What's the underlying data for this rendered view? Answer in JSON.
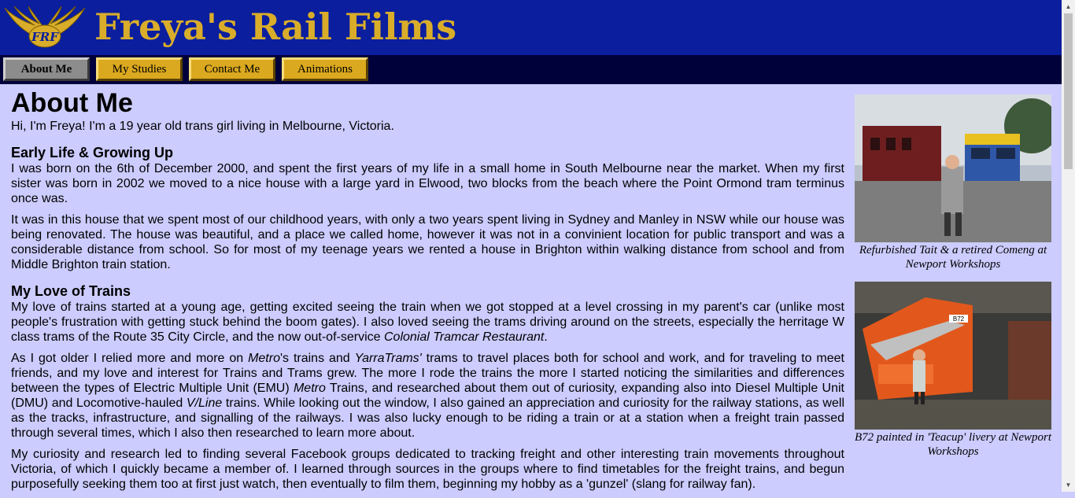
{
  "header": {
    "logo_text": "FRF",
    "site_title": "Freya's Rail Films"
  },
  "nav": [
    {
      "label": "About Me",
      "active": true
    },
    {
      "label": "My Studies",
      "active": false
    },
    {
      "label": "Contact Me",
      "active": false
    },
    {
      "label": "Animations",
      "active": false
    }
  ],
  "main": {
    "title": "About Me",
    "intro": "Hi, I'm Freya! I'm a 19 year old trans girl living in Melbourne, Victoria.",
    "sections": [
      {
        "heading": "Early Life & Growing Up",
        "paragraphs": [
          "I was born on the 6th of December 2000, and spent the first years of my life in a small home in South Melbourne near the market. When my first sister was born in 2002 we moved to a nice house with a large yard in Elwood, two blocks from the beach where the Point Ormond tram terminus once was.",
          "It was in this house that we spent most of our childhood years, with only a two years spent living in Sydney and Manley in NSW while our house was being renovated. The house was beautiful, and a place we called home, however it was not in a convinient location for public transport and was a considerable distance from school. So for most of my teenage years we rented a house in Brighton within walking distance from school and from Middle Brighton train station."
        ]
      },
      {
        "heading": "My Love of Trains",
        "p1_a": "My love of trains started at a young age, getting excited seeing the train when we got stopped at a level crossing in my parent's car (unlike most people's frustration with getting stuck behind the boom gates). I also loved seeing the trams driving around on the streets, especially the herritage W class trams of the Route 35 City Circle, and the now out-of-service ",
        "p1_em": "Colonial Tramcar Restaurant",
        "p1_b": ".",
        "p2_a": "As I got older I relied more and more on ",
        "p2_em1": "Metro",
        "p2_b": "'s trains and ",
        "p2_em2": "YarraTrams'",
        "p2_c": " trams to travel places both for school and work, and for traveling to meet friends, and my love and interest for Trains and Trams grew. The more I rode the trains the more I started noticing the similarities and differences between the types of Electric Multiple Unit (EMU) ",
        "p2_em3": "Metro",
        "p2_d": " Trains, and researched about them out of curiosity, expanding also into Diesel Multiple Unit (DMU) and Locomotive-hauled ",
        "p2_em4": "V/Line",
        "p2_e": " trains. While looking out the window, I also gained an appreciation and curiosity for the railway stations, as well as the tracks, infrastructure, and signalling of the railways. I was also lucky enough to be riding a train or at a station when a freight train passed through several times, which I also then researched to learn more about.",
        "p3": "My curiosity and research led to finding several Facebook groups dedicated to tracking freight and other interesting train movements throughout Victoria, of which I quickly became a member of. I learned through sources in the groups where to find timetables for the freight trains, and begun purposefully seeking them too at first just watch, then eventually to film them, beginning my hobby as a 'gunzel' (slang for railway fan)."
      }
    ]
  },
  "figures": [
    {
      "caption": "Refurbished Tait & a retired Comeng at Newport Workshops",
      "photo_icon": "train-photo"
    },
    {
      "caption": "B72 painted in 'Teacup' livery at Newport Workshops",
      "photo_icon": "locomotive-photo",
      "loco_number": "B72"
    }
  ],
  "colors": {
    "header_bg": "#0a1e9e",
    "nav_bg": "#00003a",
    "title_gold": "#d9ad2a",
    "page_bg": "#ccccff"
  }
}
